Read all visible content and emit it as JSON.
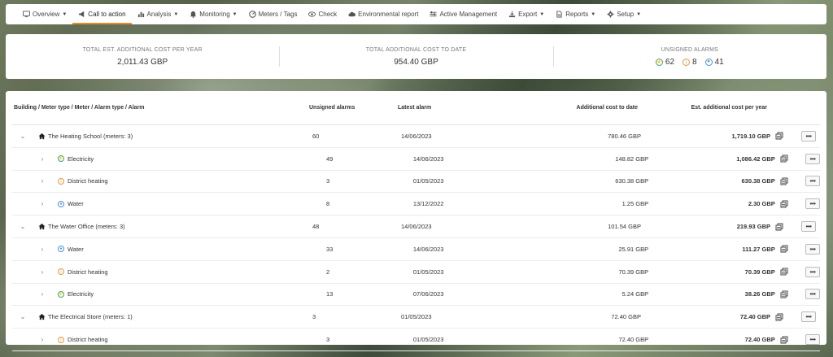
{
  "nav": {
    "items": [
      {
        "label": "Overview",
        "icon": "monitor-icon",
        "caret": true,
        "active": false
      },
      {
        "label": "Call to action",
        "icon": "megaphone-icon",
        "caret": false,
        "active": true
      },
      {
        "label": "Analysis",
        "icon": "chart-icon",
        "caret": true,
        "active": false
      },
      {
        "label": "Monitoring",
        "icon": "bell-icon",
        "caret": true,
        "active": false
      },
      {
        "label": "Meters / Tags",
        "icon": "gauge-icon",
        "caret": false,
        "active": false
      },
      {
        "label": "Check",
        "icon": "eye-icon",
        "caret": false,
        "active": false
      },
      {
        "label": "Environmental report",
        "icon": "cloud-icon",
        "caret": false,
        "active": false
      },
      {
        "label": "Active Management",
        "icon": "sliders-icon",
        "caret": false,
        "active": false
      },
      {
        "label": "Export",
        "icon": "export-icon",
        "caret": true,
        "active": false
      },
      {
        "label": "Reports",
        "icon": "document-icon",
        "caret": true,
        "active": false
      },
      {
        "label": "Setup",
        "icon": "gear-icon",
        "caret": true,
        "active": false
      }
    ],
    "accent": "#e98b2b"
  },
  "summary": {
    "annual_label": "TOTAL EST. ADDITIONAL COST PER YEAR",
    "annual_value": "2,011.43 GBP",
    "to_date_label": "TOTAL ADDITIONAL COST TO DATE",
    "to_date_value": "954.40 GBP",
    "alarms_label": "UNSIGNED ALARMS",
    "alarms": [
      {
        "type": "electricity",
        "count": "62",
        "color": "#3aa56a"
      },
      {
        "type": "heating",
        "count": "8",
        "color": "#e39a3a"
      },
      {
        "type": "water",
        "count": "41",
        "color": "#4a90d9"
      }
    ]
  },
  "table": {
    "headers": {
      "path": "Building / Meter type / Meter / Alarm type / Alarm",
      "unsigned": "Unsigned alarms",
      "latest": "Latest alarm",
      "to_date": "Additional cost to date",
      "per_year": "Est. additional cost per year"
    },
    "more_label": "•••",
    "rows": [
      {
        "level": 0,
        "expanded": true,
        "kind": "building",
        "name": "The Heating School (meters: 3)",
        "unsigned": "60",
        "latest": "14/06/2023",
        "to_date": "780.46 GBP",
        "per_year": "1,719.10 GBP"
      },
      {
        "level": 1,
        "expanded": false,
        "kind": "electricity",
        "name": "Electricity",
        "unsigned": "49",
        "latest": "14/06/2023",
        "to_date": "148.82 GBP",
        "per_year": "1,086.42 GBP"
      },
      {
        "level": 1,
        "expanded": false,
        "kind": "heating",
        "name": "District heating",
        "unsigned": "3",
        "latest": "01/05/2023",
        "to_date": "630.38 GBP",
        "per_year": "630.38 GBP"
      },
      {
        "level": 1,
        "expanded": false,
        "kind": "water",
        "name": "Water",
        "unsigned": "8",
        "latest": "13/12/2022",
        "to_date": "1.25 GBP",
        "per_year": "2.30 GBP"
      },
      {
        "level": 0,
        "expanded": true,
        "kind": "building",
        "name": "The Water Office (meters: 3)",
        "unsigned": "48",
        "latest": "14/06/2023",
        "to_date": "101.54 GBP",
        "per_year": "219.93 GBP"
      },
      {
        "level": 1,
        "expanded": false,
        "kind": "water",
        "name": "Water",
        "unsigned": "33",
        "latest": "14/06/2023",
        "to_date": "25.91 GBP",
        "per_year": "111.27 GBP"
      },
      {
        "level": 1,
        "expanded": false,
        "kind": "heating",
        "name": "District heating",
        "unsigned": "2",
        "latest": "01/05/2023",
        "to_date": "70.39 GBP",
        "per_year": "70.39 GBP"
      },
      {
        "level": 1,
        "expanded": false,
        "kind": "electricity",
        "name": "Electricity",
        "unsigned": "13",
        "latest": "07/06/2023",
        "to_date": "5.24 GBP",
        "per_year": "38.26 GBP"
      },
      {
        "level": 0,
        "expanded": true,
        "kind": "building",
        "name": "The Electrical Store (meters: 1)",
        "unsigned": "3",
        "latest": "01/05/2023",
        "to_date": "72.40 GBP",
        "per_year": "72.40 GBP"
      },
      {
        "level": 1,
        "expanded": false,
        "kind": "heating",
        "name": "District heating",
        "unsigned": "3",
        "latest": "01/05/2023",
        "to_date": "72.40 GBP",
        "per_year": "72.40 GBP"
      }
    ]
  }
}
